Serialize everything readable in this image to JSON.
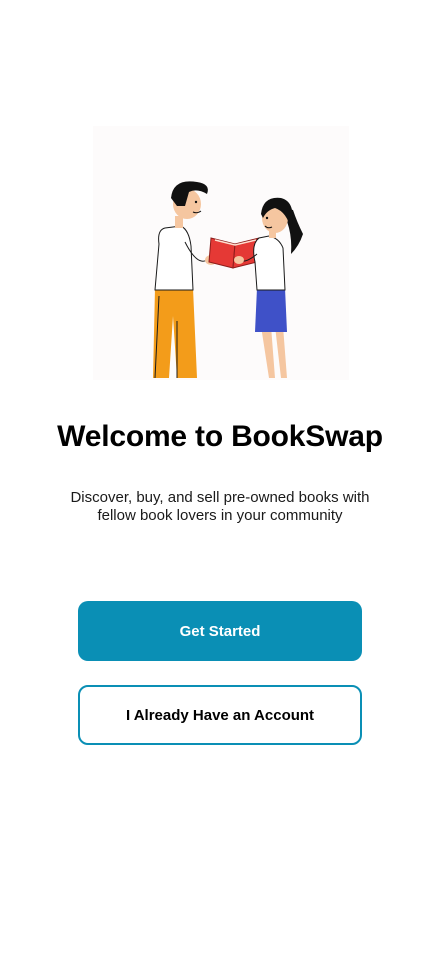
{
  "welcome": {
    "title": "Welcome to BookSwap",
    "subtitle": "Discover, buy, and sell pre-owned books with fellow book lovers in your community"
  },
  "actions": {
    "primary_label": "Get Started",
    "secondary_label": "I Already Have an Account"
  },
  "colors": {
    "accent": "#0a8fb5",
    "book": "#e53935",
    "skirt": "#3f51c8",
    "pants": "#f39c1a"
  }
}
